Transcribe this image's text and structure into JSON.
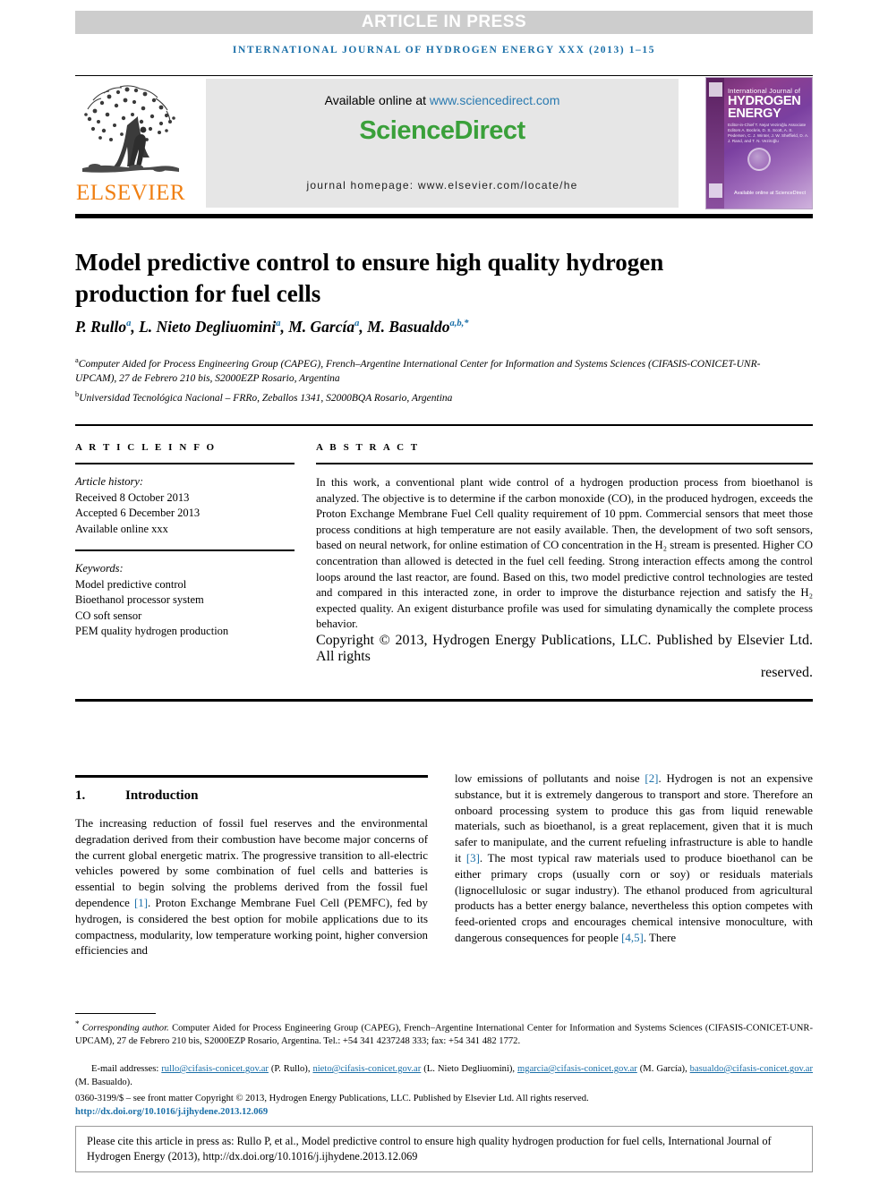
{
  "banner": {
    "text": "ARTICLE IN PRESS"
  },
  "running_head": "INTERNATIONAL JOURNAL OF HYDROGEN ENERGY XXX (2013) 1–15",
  "publisher": {
    "elsevier_wordmark": "ELSEVIER",
    "available_prefix": "Available online at ",
    "available_url": "www.sciencedirect.com",
    "sciencedirect_brand": "ScienceDirect",
    "journal_homepage": "journal homepage: www.elsevier.com/locate/he"
  },
  "cover": {
    "line1": "International Journal of",
    "line2": "HYDROGEN ENERGY",
    "editors": "Editor-in-Chief  T. Nejat Veziroğlu    Associate Editors  A. Bockris, D. S. Scott, A. S. Pedersen, C. J. Winter, J. W. Sheffield, D. A. J. Rand, and T. N. Veziroğlu",
    "footer": "Available online at ScienceDirect"
  },
  "article": {
    "title": "Model predictive control to ensure high quality hydrogen production for fuel cells",
    "authors_html": "P. Rullo <sup>a</sup>, L. Nieto Degliuomini <sup>a</sup>, M. García <sup>a</sup>, M. Basualdo <sup>a,b,*</sup>",
    "affiliation_a": "Computer Aided for Process Engineering Group (CAPEG), French–Argentine International Center for Information and Systems Sciences (CIFASIS-CONICET-UNR-UPCAM), 27 de Febrero 210 bis, S2000EZP Rosario, Argentina",
    "affiliation_b": "Universidad Tecnológica Nacional – FRRo, Zeballos 1341, S2000BQA Rosario, Argentina"
  },
  "article_info": {
    "heading": "A R T I C L E   I N F O",
    "history_label": "Article history:",
    "received": "Received 8 October 2013",
    "accepted": "Accepted 6 December 2013",
    "available": "Available online xxx",
    "keywords_label": "Keywords:",
    "keywords": [
      "Model predictive control",
      "Bioethanol processor system",
      "CO soft sensor",
      "PEM quality hydrogen production"
    ]
  },
  "abstract": {
    "heading": "A B S T R A C T",
    "body": "In this work, a conventional plant wide control of a hydrogen production process from bioethanol is analyzed. The objective is to determine if the carbon monoxide (CO), in the produced hydrogen, exceeds the Proton Exchange Membrane Fuel Cell quality requirement of 10 ppm. Commercial sensors that meet those process conditions at high temperature are not easily available. Then, the development of two soft sensors, based on neural network, for online estimation of CO concentration in the H₂ stream is presented. Higher CO concentration than allowed is detected in the fuel cell feeding. Strong interaction effects among the control loops around the last reactor, are found. Based on this, two model predictive control technologies are tested and compared in this interacted zone, in order to improve the disturbance rejection and satisfy the H₂ expected quality. An exigent disturbance profile was used for simulating dynamically the complete process behavior.",
    "copyright": "Copyright © 2013, Hydrogen Energy Publications, LLC. Published by Elsevier Ltd. All rights",
    "copyright_last": "reserved."
  },
  "body": {
    "section_number": "1.",
    "section_title": "Introduction",
    "left_p1_a": "The increasing reduction of fossil fuel reserves and the environmental degradation derived from their combustion have become major concerns of the current global energetic matrix. The progressive transition to all-electric vehicles powered by some combination of fuel cells and batteries is essential to begin solving the problems derived from the fossil fuel dependence ",
    "left_cite1": "[1]",
    "left_p1_b": ". Proton Exchange Membrane Fuel Cell (PEMFC), fed by hydrogen, is considered the best option for mobile applications due to its compactness, modularity, low temperature working point, higher conversion efficiencies and",
    "right_p1_a": "low emissions of pollutants and noise ",
    "right_cite2": "[2]",
    "right_p1_b": ". Hydrogen is not an expensive substance, but it is extremely dangerous to transport and store. Therefore an onboard processing system to produce this gas from liquid renewable materials, such as bioethanol, is a great replacement, given that it is much safer to manipulate, and the current refueling infrastructure is able to handle it ",
    "right_cite3": "[3]",
    "right_p1_c": ". The most typical raw materials used to produce bioethanol can be either primary crops (usually corn or soy) or residuals materials (lignocellulosic or sugar industry). The ethanol produced from agricultural products has a better energy balance, nevertheless this option competes with feed-oriented crops and encourages chemical intensive monoculture, with dangerous consequences for people ",
    "right_cite45": "[4,5]",
    "right_p1_d": ". There"
  },
  "footnotes": {
    "corresponding_label": "Corresponding author.",
    "corresponding_body": " Computer Aided for Process Engineering Group (CAPEG), French–Argentine International Center for Information and Systems Sciences (CIFASIS-CONICET-UNR-UPCAM), 27 de Febrero 210 bis, S2000EZP Rosario, Argentina. Tel.: +54 341 4237248 333; fax: +54 341 482 1772.",
    "email_label": "E-mail addresses: ",
    "email1": "rullo@cifasis-conicet.gov.ar",
    "email1_owner": " (P. Rullo), ",
    "email2": "nieto@cifasis-conicet.gov.ar",
    "email2_owner": " (L. Nieto Degliuomini), ",
    "email3": "mgarcia@cifasis-conicet.gov.ar",
    "email3_owner": " (M. García), ",
    "email4": "basualdo@cifasis-conicet.gov.ar",
    "email4_owner": " (M. Basualdo).",
    "issn_line": "0360-3199/$ – see front matter Copyright © 2013, Hydrogen Energy Publications, LLC. Published by Elsevier Ltd. All rights reserved.",
    "doi_link": "http://dx.doi.org/10.1016/j.ijhydene.2013.12.069"
  },
  "cite_box": {
    "text": "Please cite this article in press as: Rullo P, et al., Model predictive control to ensure high quality hydrogen production for fuel cells, International Journal of Hydrogen Energy (2013), http://dx.doi.org/10.1016/j.ijhydene.2013.12.069"
  },
  "colors": {
    "accent_blue": "#1a6fa8",
    "elsevier_orange": "#f07f12",
    "sciencedirect_green": "#3aa03a",
    "banner_gray": "#cdcdcd"
  }
}
